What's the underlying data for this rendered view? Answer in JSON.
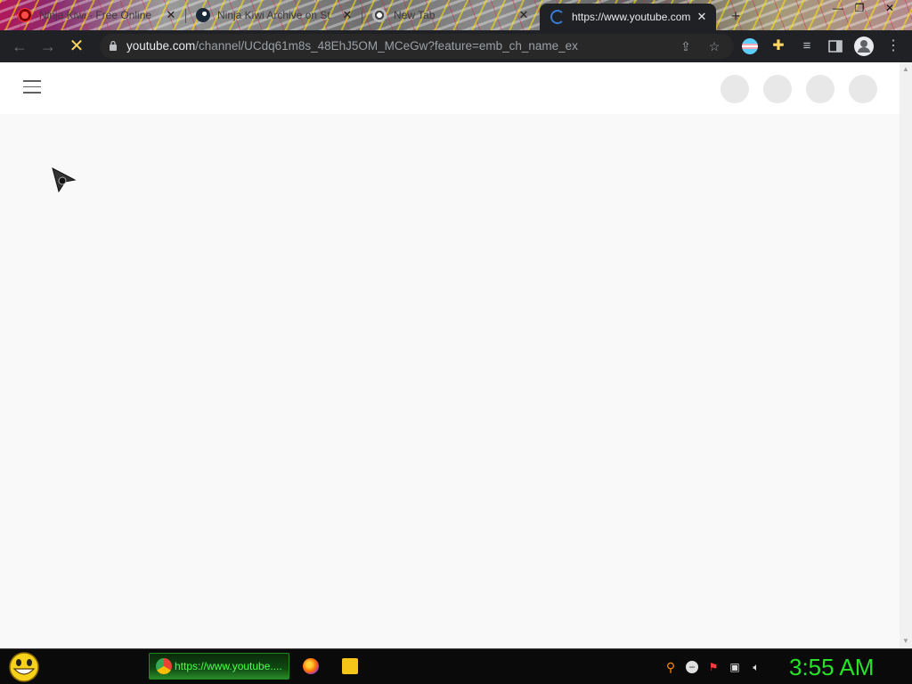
{
  "browser": {
    "tabs": [
      {
        "title": "Ninja Kiwi - Free Online",
        "icon": "ninjakiwi-icon",
        "active": false
      },
      {
        "title": "Ninja Kiwi Archive on St",
        "icon": "steam-icon",
        "active": false
      },
      {
        "title": "New Tab",
        "icon": "chrome-icon",
        "active": false
      },
      {
        "title": "https://www.youtube.com",
        "icon": "loading-spinner-icon",
        "active": true
      }
    ],
    "new_tab_label": "+",
    "address": {
      "host": "youtube.com",
      "path": "/channel/UCdq61m8s_48EhJ5OM_MCeGw?feature=emb_ch_name_ex"
    }
  },
  "page": {
    "masthead_placeholders": 4
  },
  "taskbar": {
    "active_task_label": "https://www.youtube....",
    "clock": "3:55 AM"
  },
  "colors": {
    "toolbar": "#202124",
    "clock": "#27e327",
    "page_bg": "#f9f9f9"
  }
}
